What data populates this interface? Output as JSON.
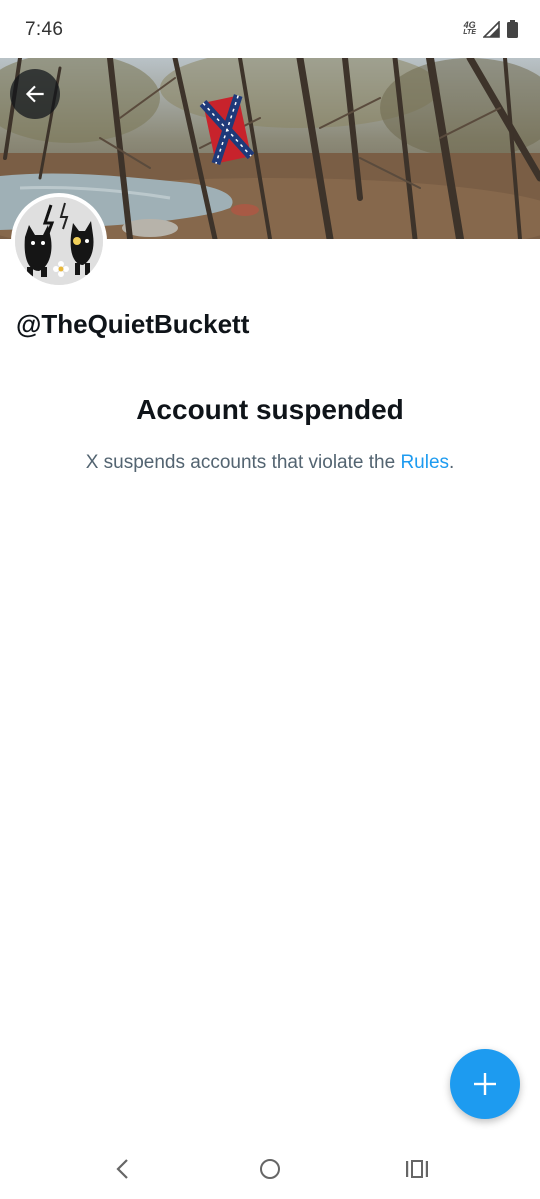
{
  "status_bar": {
    "time": "7:46",
    "network_top": "4G",
    "network_bottom": "LTE",
    "icons": [
      "network-type-icon",
      "signal-icon",
      "battery-icon"
    ]
  },
  "header": {
    "back_icon": "arrow-left-icon"
  },
  "profile": {
    "handle": "@TheQuietBuckett"
  },
  "notice": {
    "title": "Account suspended",
    "text_before": "X suspends accounts that violate the ",
    "link_text": "Rules",
    "text_after": "."
  },
  "fab": {
    "icon": "plus-icon"
  },
  "nav_bar": {
    "items": [
      "back-icon",
      "home-icon",
      "recents-icon"
    ]
  },
  "colors": {
    "accent": "#1d9bf0",
    "text_primary": "#0f1419",
    "text_secondary": "#536471"
  }
}
